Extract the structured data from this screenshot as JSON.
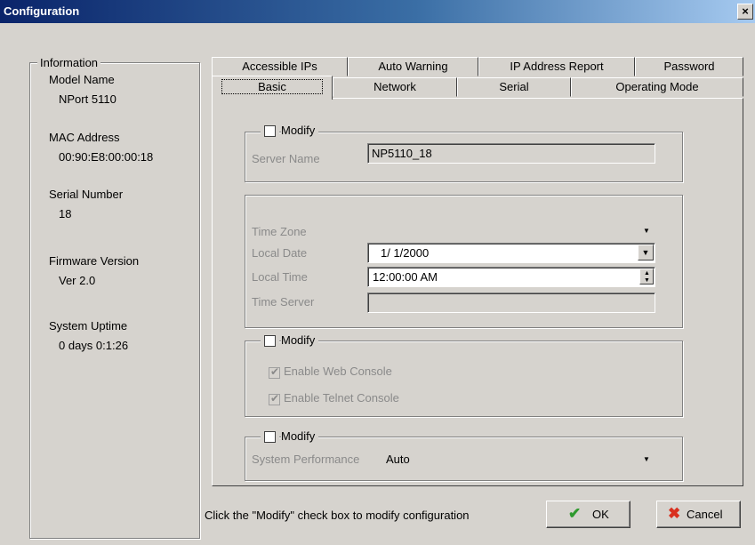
{
  "window": {
    "title": "Configuration",
    "close_glyph": "×"
  },
  "info": {
    "legend": "Information",
    "fields": [
      {
        "label": "Model Name",
        "value": "NPort 5110"
      },
      {
        "label": "MAC Address",
        "value": "00:90:E8:00:00:18"
      },
      {
        "label": "Serial Number",
        "value": "18"
      },
      {
        "label": "Firmware Version",
        "value": "Ver 2.0"
      },
      {
        "label": "System Uptime",
        "value": "0 days 0:1:26"
      }
    ]
  },
  "tabs": {
    "back": [
      "Accessible IPs",
      "Auto Warning",
      "IP Address Report",
      "Password"
    ],
    "front": [
      "Basic",
      "Network",
      "Serial",
      "Operating Mode"
    ],
    "active": "Basic"
  },
  "server_group": {
    "modify_label": "Modify",
    "server_name_label": "Server Name",
    "server_name_value": "NP5110_18"
  },
  "time_group": {
    "time_zone_label": "Time Zone",
    "local_date_label": "Local Date",
    "local_date_value": "1/ 1/2000",
    "local_time_label": "Local Time",
    "local_time_value": "12:00:00 AM",
    "time_server_label": "Time Server",
    "time_server_value": ""
  },
  "console_group": {
    "modify_label": "Modify",
    "web_console_label": "Enable Web Console",
    "web_console_checked": true,
    "telnet_console_label": "Enable Telnet Console",
    "telnet_console_checked": true
  },
  "performance_group": {
    "modify_label": "Modify",
    "system_performance_label": "System Performance",
    "system_performance_value": "Auto"
  },
  "footer": {
    "hint": "Click the \"Modify\" check box to modify configuration",
    "ok_label": "OK",
    "cancel_label": "Cancel"
  },
  "colors": {
    "face": "#d6d3ce",
    "title_start": "#0a246a",
    "title_end": "#a6caf0",
    "ok_icon": "#2f9a2f",
    "cancel_icon": "#d9301e"
  }
}
